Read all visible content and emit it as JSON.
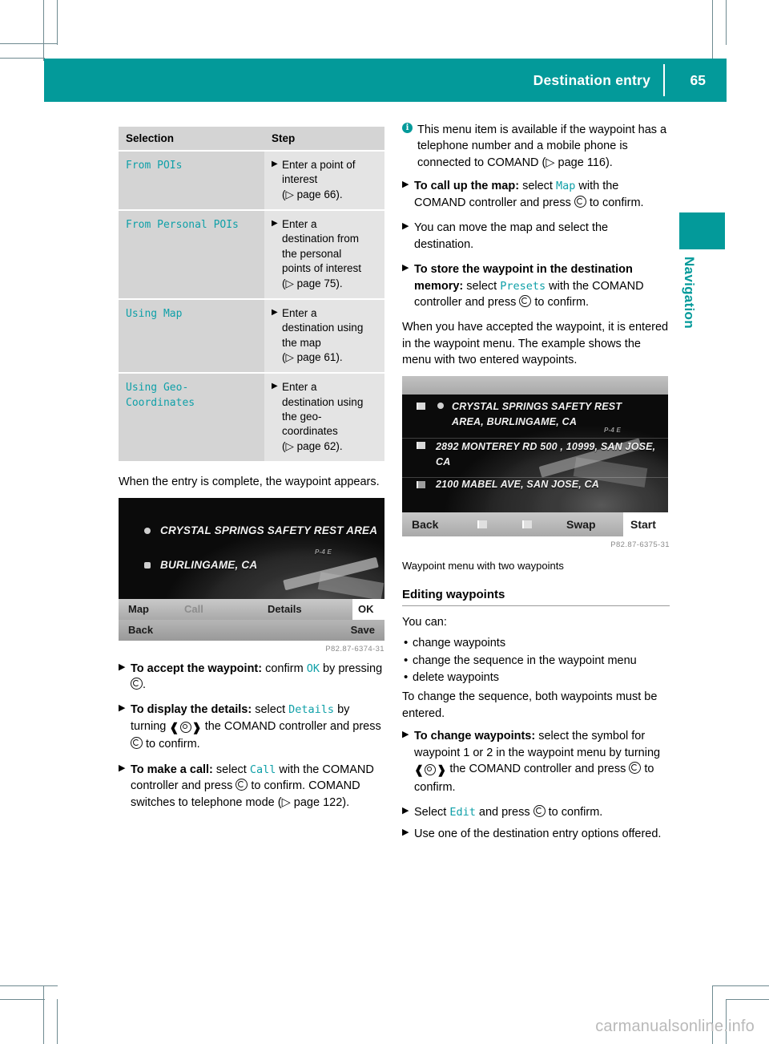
{
  "header": {
    "title": "Destination entry",
    "page_number": "65"
  },
  "side_tab": {
    "label": "Navigation",
    "accent_color": "#039a9a"
  },
  "left_column": {
    "table": {
      "headers": [
        "Selection",
        "Step"
      ],
      "rows": [
        {
          "selection": "From POIs",
          "step_lines": [
            "Enter a point of",
            "interest",
            "(▷ page 66)."
          ]
        },
        {
          "selection": "From Personal POIs",
          "step_lines": [
            "Enter a",
            "destination from",
            "the personal",
            "points of interest",
            "(▷ page 75)."
          ]
        },
        {
          "selection": "Using Map",
          "step_lines": [
            "Enter a",
            "destination using",
            "the map",
            "(▷ page 61)."
          ]
        },
        {
          "selection": "Using Geo-Coordinates",
          "step_lines": [
            "Enter a",
            "destination using",
            "the geo-",
            "coordinates",
            "(▷ page 62)."
          ]
        }
      ]
    },
    "intro_paragraph": "When the entry is complete, the waypoint appears.",
    "screenshot": {
      "line1": "CRYSTAL SPRINGS SAFETY REST AREA",
      "line2": "BURLINGAME, CA",
      "map_label": "P-4 E",
      "softkeys_row1": [
        "Map",
        "Call",
        "Details",
        "OK"
      ],
      "softkeys_row1_highlighted": "OK",
      "softkeys_row1_dimmed": "Call",
      "softkeys_row2_left": "Back",
      "softkeys_row2_right": "Save",
      "figure_code": "P82.87-6374-31"
    },
    "steps": [
      {
        "bold": "To accept the waypoint:",
        "rest_before_mono": " confirm ",
        "mono": "OK",
        "rest_after_mono": " by pressing ",
        "glyph": "press-knob",
        "tail": "."
      },
      {
        "bold": "To display the details:",
        "rest_before_mono": " select ",
        "mono": "Details",
        "rest_after_mono": " by turning ",
        "glyph": "turn-knob",
        "tail": " the COMAND controller and press ",
        "glyph2": "press-knob",
        "tail2": " to confirm."
      },
      {
        "bold": "To make a call:",
        "rest_before_mono": " select ",
        "mono": "Call",
        "rest_after_mono": " with the COMAND controller and press ",
        "glyph": "press-knob",
        "tail": " to confirm. COMAND switches to telephone mode (▷ page 122)."
      }
    ]
  },
  "right_column": {
    "note": "This menu item is available if the waypoint has a telephone number and a mobile phone is connected to COMAND (▷ page 116).",
    "note_icon": "info-icon",
    "steps_top": [
      {
        "bold": "To call up the map:",
        "rest_before_mono": " select ",
        "mono": "Map",
        "rest_after_mono": " with the COMAND controller and press ",
        "glyph": "press-knob",
        "tail": " to confirm."
      },
      {
        "bold": "",
        "plain": "You can move the map and select the destination."
      },
      {
        "bold": "To store the waypoint in the destination memory:",
        "rest_before_mono": " select ",
        "mono": "Presets",
        "rest_after_mono": " with the COMAND controller and press ",
        "glyph": "press-knob",
        "tail": " to confirm."
      }
    ],
    "paragraph": "When you have accepted the waypoint, it is entered in the waypoint menu. The example shows the menu with two entered waypoints.",
    "screenshot": {
      "entries": [
        "CRYSTAL SPRINGS SAFETY REST AREA, BURLINGAME, CA",
        "2892 MONTEREY RD 500 , 10999, SAN JOSE, CA",
        "2100 MABEL AVE, SAN JOSE, CA"
      ],
      "map_label": "P-4 E",
      "softkeys": [
        "Back",
        "Swap",
        "Start"
      ],
      "softkeys_highlighted": "Start",
      "figure_code": "P82.87-6375-31"
    },
    "figure_caption": "Waypoint menu with two waypoints",
    "section_heading": "Editing waypoints",
    "you_can_label": "You can:",
    "bullets": [
      "change waypoints",
      "change the sequence in the waypoint menu",
      "delete waypoints"
    ],
    "paragraph2": "To change the sequence, both waypoints must be entered.",
    "steps_bottom": [
      {
        "bold": "To change waypoints:",
        "rest_before_mono": " select the symbol for waypoint 1 or 2 in the waypoint menu by turning ",
        "glyph": "turn-knob",
        "tail": " the COMAND controller and press ",
        "glyph2": "press-knob",
        "tail2": " to confirm."
      },
      {
        "bold": "",
        "plain_before_mono": "Select ",
        "mono": "Edit",
        "plain_after_mono": " and press ",
        "glyph": "press-knob",
        "tail": " to confirm."
      },
      {
        "bold": "",
        "plain": "Use one of the destination entry options offered."
      }
    ]
  },
  "watermark": "carmanualsonline.info"
}
